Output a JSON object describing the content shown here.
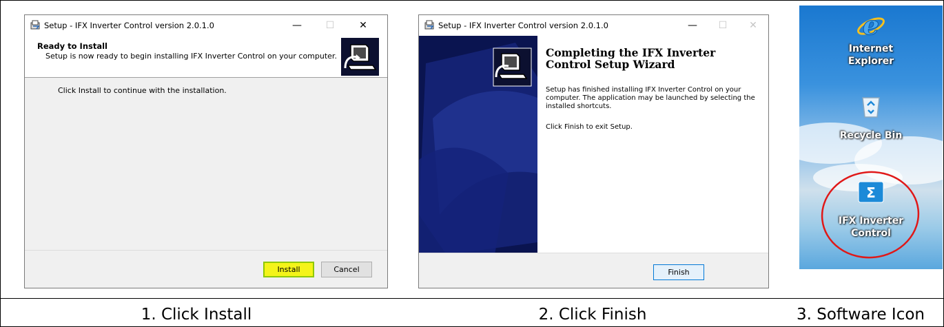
{
  "step1": {
    "window_title": "Setup - IFX Inverter Control version 2.0.1.0",
    "header_title": "Ready to Install",
    "header_subtitle": "Setup is now ready to begin installing IFX Inverter Control on your computer.",
    "body_text": "Click Install to continue with the installation.",
    "install_label": "Install",
    "cancel_label": "Cancel",
    "caption": "1. Click Install"
  },
  "step2": {
    "window_title": "Setup - IFX Inverter Control version 2.0.1.0",
    "heading": "Completing the IFX Inverter Control Setup Wizard",
    "paragraph1": "Setup has finished installing IFX Inverter Control on your computer. The application may be launched by selecting the installed shortcuts.",
    "paragraph2": "Click Finish to exit Setup.",
    "finish_label": "Finish",
    "caption": "2. Click Finish"
  },
  "step3": {
    "icons": [
      {
        "label_line1": "Internet",
        "label_line2": "Explorer",
        "icon": "internet-explorer-icon"
      },
      {
        "label_line1": "Recycle Bin",
        "icon": "recycle-bin-icon"
      },
      {
        "label_line1": "IFX Inverter",
        "label_line2": "Control",
        "icon": "ifx-inverter-control-icon"
      }
    ],
    "caption": "3. Software Icon"
  },
  "window_controls": {
    "minimize": "—",
    "maximize": "☐",
    "close": "✕"
  },
  "colors": {
    "highlight": "#f4f41a",
    "wizard_banner": "#0a1450",
    "circle": "#e01818",
    "focus_border": "#0078d7"
  }
}
